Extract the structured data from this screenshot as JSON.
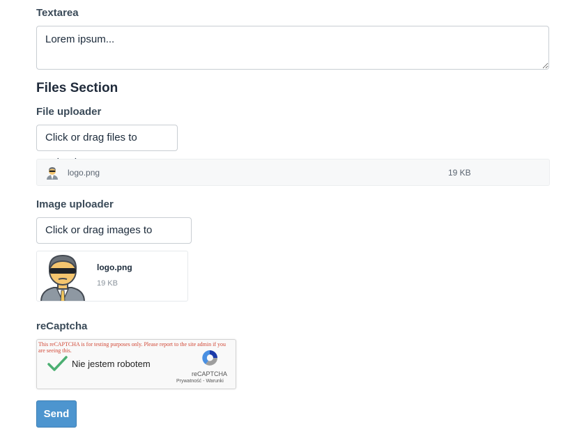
{
  "textarea": {
    "label": "Textarea",
    "value": "Lorem ipsum..."
  },
  "files_section": {
    "title": "Files Section"
  },
  "file_uploader": {
    "label": "File uploader",
    "button_label": "Click or drag files to upload",
    "files": [
      {
        "name": "logo.png",
        "size": "19 KB",
        "icon": "avatar-thumb-icon"
      }
    ]
  },
  "image_uploader": {
    "label": "Image uploader",
    "button_label": "Click or drag images to upload",
    "images": [
      {
        "name": "logo.png",
        "size": "19 KB",
        "icon": "avatar-preview-icon"
      }
    ]
  },
  "recaptcha": {
    "label": "reCaptcha",
    "warning": "This reCAPTCHA is for testing purposes only. Please report to the site admin if you are seeing this.",
    "checkbox_label": "Nie jestem robotem",
    "brand": "reCAPTCHA",
    "privacy": "Prywatność",
    "separator": "-",
    "terms": "Warunki",
    "checked": true
  },
  "actions": {
    "send_label": "Send"
  },
  "colors": {
    "primary": "#4d95cf",
    "warning_red": "#d14836",
    "check_green": "#4caf72"
  }
}
